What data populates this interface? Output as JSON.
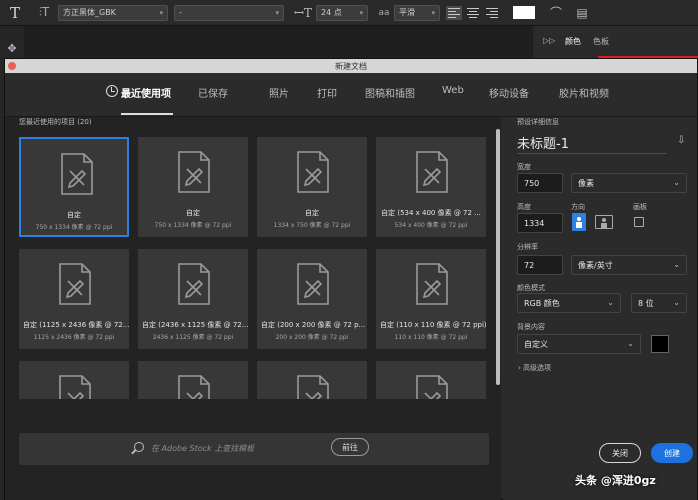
{
  "options_bar": {
    "tool_glyph": "T",
    "font_family": "方正黑体_GBK",
    "font_style": "-",
    "font_size": "24 点",
    "aa_label": "aa",
    "antialias": "平滑",
    "swatch_color": "#ffffff"
  },
  "panels": {
    "color_tab": "颜色",
    "swatches_tab": "色板"
  },
  "dialog": {
    "title": "新建文档",
    "tabs": [
      {
        "label": "最近使用项",
        "active": true
      },
      {
        "label": "已保存"
      },
      {
        "label": "照片"
      },
      {
        "label": "打印"
      },
      {
        "label": "图稿和插图"
      },
      {
        "label": "Web"
      },
      {
        "label": "移动设备"
      },
      {
        "label": "胶片和视频"
      }
    ],
    "recent_label": "您最近使用的项目",
    "recent_count": "(20)",
    "presets": [
      {
        "name": "自定",
        "dims": "750 x 1334 像素 @ 72 ppi",
        "selected": true
      },
      {
        "name": "自定",
        "dims": "750 x 1334 像素 @ 72 ppi"
      },
      {
        "name": "自定",
        "dims": "1334 x 750 像素 @ 72 ppi"
      },
      {
        "name": "自定 (534 x 400 像素 @ 72 ...",
        "dims": "534 x 400 像素 @ 72 ppi"
      },
      {
        "name": "自定 (1125 x 2436 像素 @ 72...",
        "dims": "1125 x 2436 像素 @ 72 ppi"
      },
      {
        "name": "自定 (2436 x 1125 像素 @ 72...",
        "dims": "2436 x 1125 像素 @ 72 ppi"
      },
      {
        "name": "自定 (200 x 200 像素 @ 72 p...",
        "dims": "200 x 200 像素 @ 72 ppi"
      },
      {
        "name": "自定 (110 x 110 像素 @ 72 ppi)",
        "dims": "110 x 110 像素 @ 72 ppi"
      },
      {
        "name": "",
        "dims": ""
      },
      {
        "name": "",
        "dims": ""
      },
      {
        "name": "",
        "dims": ""
      },
      {
        "name": "",
        "dims": ""
      }
    ],
    "stock_search": {
      "placeholder": "在 Adobe Stock 上查找模板",
      "go_label": "前往"
    },
    "details": {
      "header": "预设详细信息",
      "doc_name": "未标题-1",
      "width_label": "宽度",
      "width_value": "750",
      "width_unit": "像素",
      "height_label": "高度",
      "height_value": "1334",
      "orientation_label": "方向",
      "artboard_label": "画板",
      "resolution_label": "分辨率",
      "resolution_value": "72",
      "resolution_unit": "像素/英寸",
      "color_mode_label": "颜色模式",
      "color_mode": "RGB 颜色",
      "bit_depth": "8 位",
      "bg_label": "背景内容",
      "bg_value": "自定义",
      "bg_color": "#000000",
      "advanced_label": "高级选项",
      "close_label": "关闭",
      "create_label": "创建"
    }
  },
  "watermark": "头条 @浑进0gz"
}
